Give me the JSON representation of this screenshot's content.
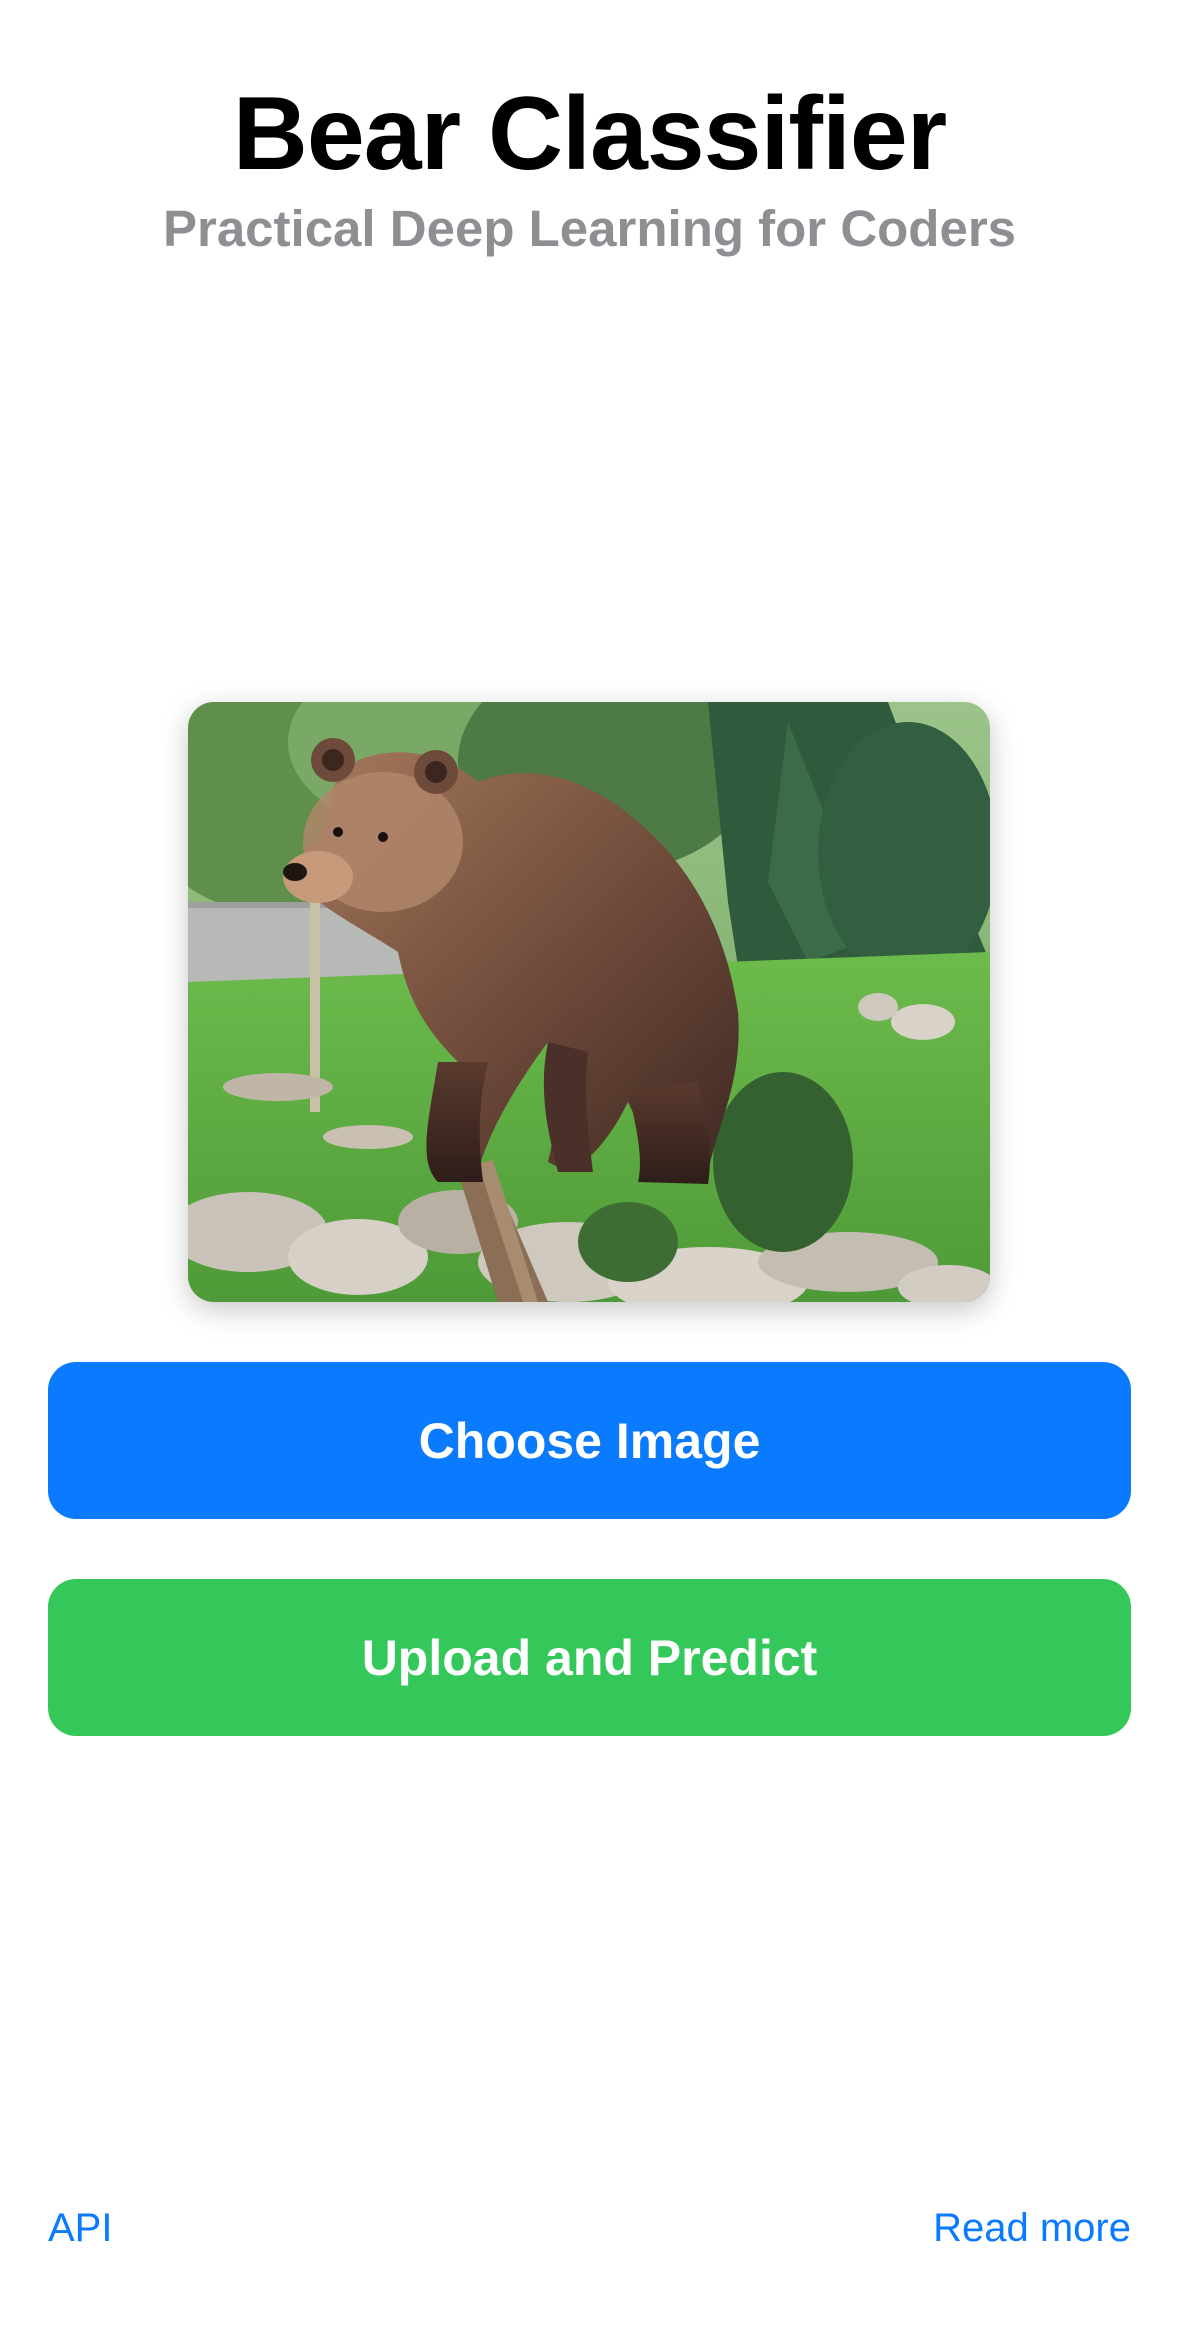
{
  "header": {
    "title": "Bear Classifier",
    "subtitle": "Practical Deep Learning for Coders"
  },
  "preview": {
    "alt": "Brown bear standing on a tree stump"
  },
  "actions": {
    "choose_label": "Choose Image",
    "upload_label": "Upload and Predict"
  },
  "footer": {
    "api_label": "API",
    "read_more_label": "Read more"
  },
  "colors": {
    "primary": "#0a7aff",
    "success": "#34c759",
    "subtitle": "#8e8e93"
  }
}
